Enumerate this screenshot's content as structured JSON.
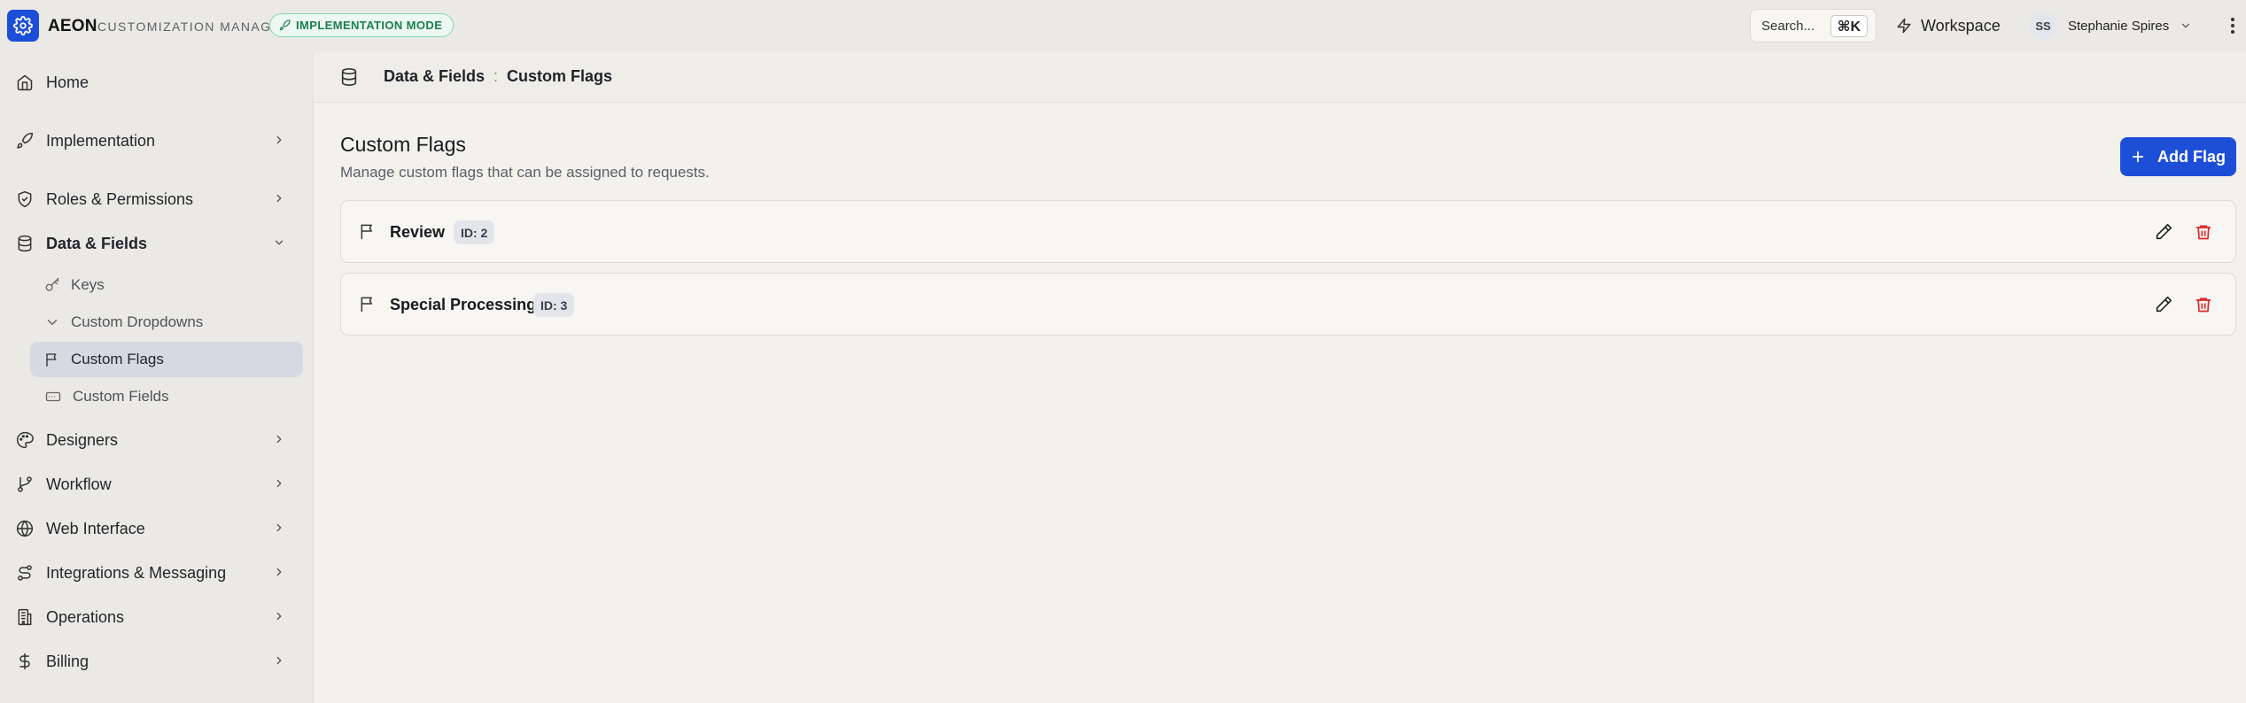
{
  "app": {
    "brand": "AEON",
    "subtitle": "CUSTOMIZATION MANAGER",
    "mode_badge": "IMPLEMENTATION MODE",
    "search_label": "Search...",
    "search_shortcut": "⌘K",
    "workspace_label": "Workspace",
    "user_initials": "SS",
    "user_name": "Stephanie Spires"
  },
  "sidebar": {
    "items": [
      {
        "label": "Home",
        "icon": "home-icon"
      },
      {
        "label": "Implementation",
        "icon": "rocket-icon"
      },
      {
        "label": "Roles & Permissions",
        "icon": "shield-icon"
      },
      {
        "label": "Data & Fields",
        "icon": "database-icon",
        "expanded": true
      },
      {
        "label": "Designers",
        "icon": "palette-icon"
      },
      {
        "label": "Workflow",
        "icon": "git-branch-icon"
      },
      {
        "label": "Web Interface",
        "icon": "globe-icon"
      },
      {
        "label": "Integrations & Messaging",
        "icon": "route-icon"
      },
      {
        "label": "Operations",
        "icon": "building-icon"
      },
      {
        "label": "Billing",
        "icon": "dollar-icon"
      }
    ],
    "sub_items": [
      {
        "label": "Keys",
        "icon": "key-icon"
      },
      {
        "label": "Custom Dropdowns",
        "icon": "chevron-down-icon"
      },
      {
        "label": "Custom Flags",
        "icon": "flag-icon",
        "active": true
      },
      {
        "label": "Custom Fields",
        "icon": "text-field-icon"
      }
    ]
  },
  "breadcrumb": {
    "section": "Data & Fields",
    "separator": ":",
    "page": "Custom Flags"
  },
  "page": {
    "title": "Custom Flags",
    "description": "Manage custom flags that can be assigned to requests.",
    "add_button": "Add Flag"
  },
  "flags": [
    {
      "name": "Review",
      "id_label": "ID: 2"
    },
    {
      "name": "Special Processing",
      "id_label": "ID: 3"
    }
  ],
  "colors": {
    "accent": "#1d4ed8",
    "mode_badge_text": "#1a7f4e",
    "delete": "#dc2626"
  }
}
